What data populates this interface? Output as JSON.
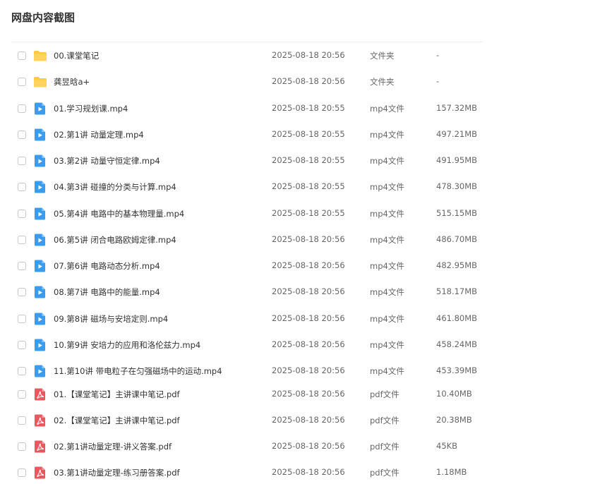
{
  "page_title": "网盘内容截图",
  "colors": {
    "folder": "#FFC940",
    "video": "#3A9BEF",
    "pdf": "#E8585E"
  },
  "files": [
    {
      "name": "00.课堂笔记",
      "time": "2025-08-18 20:56",
      "type": "文件夹",
      "size": "-",
      "icon": "folder-icon"
    },
    {
      "name": "龚昱晗a+",
      "time": "2025-08-18 20:56",
      "type": "文件夹",
      "size": "-",
      "icon": "folder-icon"
    },
    {
      "name": "01.学习规划课.mp4",
      "time": "2025-08-18 20:55",
      "type": "mp4文件",
      "size": "157.32MB",
      "icon": "video-file-icon"
    },
    {
      "name": "02.第1讲 动量定理.mp4",
      "time": "2025-08-18 20:55",
      "type": "mp4文件",
      "size": "497.21MB",
      "icon": "video-file-icon"
    },
    {
      "name": "03.第2讲 动量守恒定律.mp4",
      "time": "2025-08-18 20:55",
      "type": "mp4文件",
      "size": "491.95MB",
      "icon": "video-file-icon"
    },
    {
      "name": "04.第3讲 碰撞的分类与计算.mp4",
      "time": "2025-08-18 20:55",
      "type": "mp4文件",
      "size": "478.30MB",
      "icon": "video-file-icon"
    },
    {
      "name": "05.第4讲 电路中的基本物理量.mp4",
      "time": "2025-08-18 20:55",
      "type": "mp4文件",
      "size": "515.15MB",
      "icon": "video-file-icon"
    },
    {
      "name": "06.第5讲 闭合电路欧姆定律.mp4",
      "time": "2025-08-18 20:56",
      "type": "mp4文件",
      "size": "486.70MB",
      "icon": "video-file-icon"
    },
    {
      "name": "07.第6讲 电路动态分析.mp4",
      "time": "2025-08-18 20:56",
      "type": "mp4文件",
      "size": "482.95MB",
      "icon": "video-file-icon"
    },
    {
      "name": "08.第7讲 电路中的能量.mp4",
      "time": "2025-08-18 20:56",
      "type": "mp4文件",
      "size": "518.17MB",
      "icon": "video-file-icon"
    },
    {
      "name": "09.第8讲 磁场与安培定则.mp4",
      "time": "2025-08-18 20:56",
      "type": "mp4文件",
      "size": "461.80MB",
      "icon": "video-file-icon"
    },
    {
      "name": "10.第9讲 安培力的应用和洛伦兹力.mp4",
      "time": "2025-08-18 20:56",
      "type": "mp4文件",
      "size": "458.24MB",
      "icon": "video-file-icon"
    },
    {
      "name": "11.第10讲 带电粒子在匀强磁场中的运动.mp4",
      "time": "2025-08-18 20:56",
      "type": "mp4文件",
      "size": "453.39MB",
      "icon": "video-file-icon"
    },
    {
      "name": "01.【课堂笔记】主讲课中笔记.pdf",
      "time": "2025-08-18 20:56",
      "type": "pdf文件",
      "size": "10.40MB",
      "icon": "pdf-file-icon"
    },
    {
      "name": "02.【课堂笔记】主讲课中笔记.pdf",
      "time": "2025-08-18 20:56",
      "type": "pdf文件",
      "size": "20.38MB",
      "icon": "pdf-file-icon"
    },
    {
      "name": "02.第1讲动量定理-讲义答案.pdf",
      "time": "2025-08-18 20:56",
      "type": "pdf文件",
      "size": "45KB",
      "icon": "pdf-file-icon"
    },
    {
      "name": "03.第1讲动量定理-练习册答案.pdf",
      "time": "2025-08-18 20:56",
      "type": "pdf文件",
      "size": "1.18MB",
      "icon": "pdf-file-icon"
    }
  ]
}
